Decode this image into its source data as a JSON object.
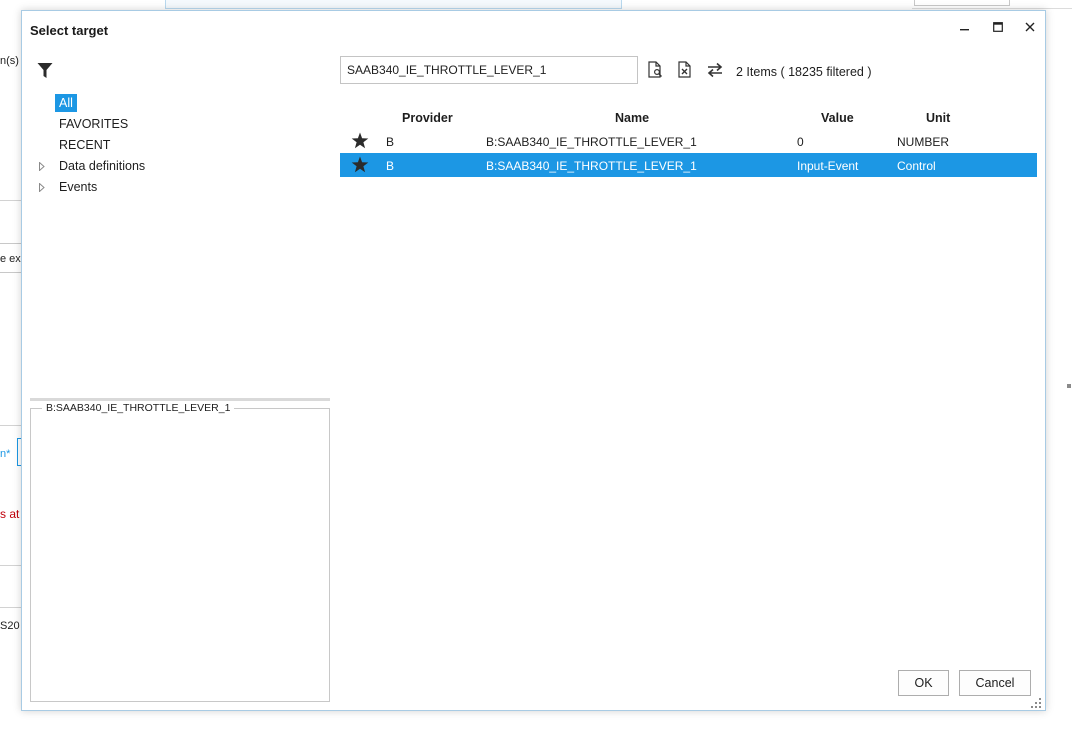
{
  "background": {
    "fragments": [
      "n(s) i",
      "e exe",
      "n*",
      "s at",
      "S20"
    ],
    "fragment_accent": "#c0000b"
  },
  "dialog": {
    "title": "Select target",
    "window_buttons": [
      "minimize-icon",
      "maximize-icon",
      "close-icon"
    ]
  },
  "tree": {
    "items": [
      {
        "label": "All",
        "selected": true,
        "expandable": false
      },
      {
        "label": "FAVORITES",
        "selected": false,
        "expandable": false
      },
      {
        "label": "RECENT",
        "selected": false,
        "expandable": false
      },
      {
        "label": "Data definitions",
        "selected": false,
        "expandable": true
      },
      {
        "label": "Events",
        "selected": false,
        "expandable": true
      }
    ]
  },
  "details": {
    "legend": "B:SAAB340_IE_THROTTLE_LEVER_1"
  },
  "search": {
    "value": "SAAB340_IE_THROTTLE_LEVER_1",
    "placeholder": ""
  },
  "toolbar": {
    "icons": [
      "document-search-icon",
      "document-clear-icon",
      "swap-arrows-icon"
    ],
    "count_text": "2 Items ( 18235 filtered )"
  },
  "table": {
    "columns": [
      "Provider",
      "Name",
      "Value",
      "Unit"
    ],
    "rows": [
      {
        "star": "★",
        "provider": "B",
        "name": "B:SAAB340_IE_THROTTLE_LEVER_1",
        "value": "0",
        "unit": "NUMBER",
        "selected": false
      },
      {
        "star": "★",
        "provider": "B",
        "name": "B:SAAB340_IE_THROTTLE_LEVER_1",
        "value": "Input-Event",
        "unit": "Control",
        "selected": true
      }
    ]
  },
  "buttons": {
    "ok": "OK",
    "cancel": "Cancel"
  },
  "colors": {
    "accent": "#1c97e4",
    "dialog_border": "#a8cbe4"
  }
}
